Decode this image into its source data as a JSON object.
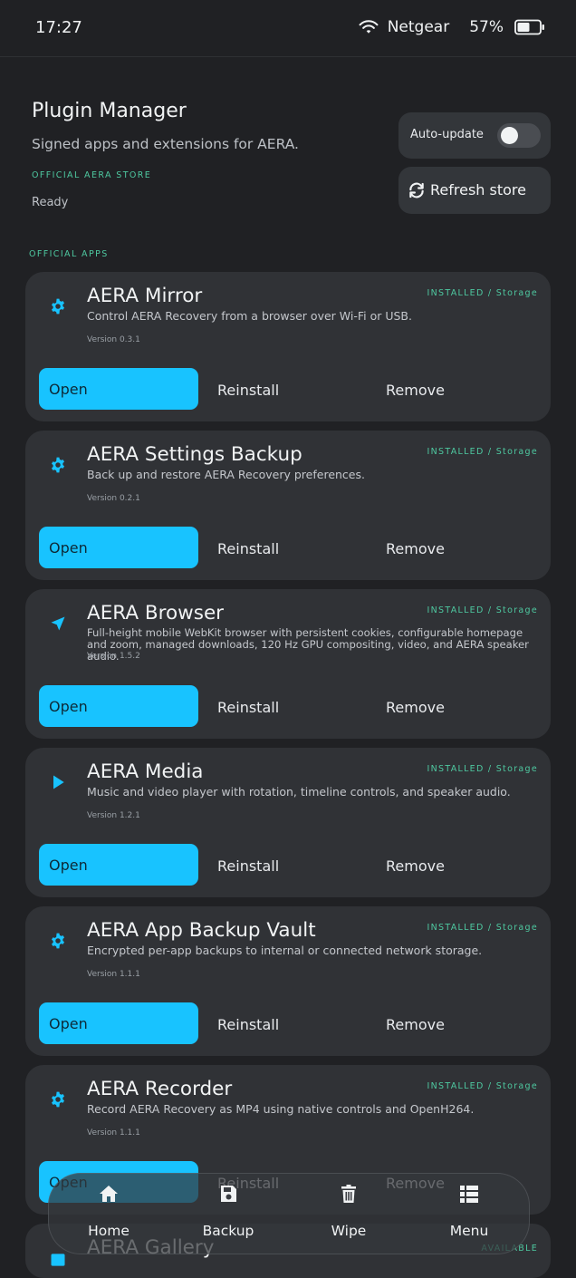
{
  "status_bar": {
    "time": "17:27",
    "network": "Netgear",
    "battery": "57%"
  },
  "header": {
    "title": "Plugin Manager",
    "subtitle": "Signed apps and extensions for AERA.",
    "store_label": "OFFICIAL AERA STORE",
    "status": "Ready",
    "auto_update_label": "Auto-update",
    "auto_update_on": false,
    "refresh_label": "Refresh store"
  },
  "section_label": "OFFICIAL APPS",
  "buttons": {
    "open": "Open",
    "reinstall": "Reinstall",
    "remove": "Remove"
  },
  "apps": [
    {
      "name": "AERA Mirror",
      "tag": "INSTALLED / Storage",
      "description": "Control AERA Recovery from a browser over Wi-Fi or USB.",
      "version": "Version 0.3.1",
      "icon": "gear-icon"
    },
    {
      "name": "AERA Settings Backup",
      "tag": "INSTALLED / Storage",
      "description": "Back up and restore AERA Recovery preferences.",
      "version": "Version 0.2.1",
      "icon": "gear-icon"
    },
    {
      "name": "AERA Browser",
      "tag": "INSTALLED / Storage",
      "description": "Full-height mobile WebKit browser with persistent cookies, configurable homepage and zoom, managed downloads, 120 Hz GPU compositing, video, and AERA speaker audio.",
      "version": "Version 1.5.2",
      "icon": "navigation-arrow-icon"
    },
    {
      "name": "AERA Media",
      "tag": "INSTALLED / Storage",
      "description": "Music and video player with rotation, timeline controls, and speaker audio.",
      "version": "Version 1.2.1",
      "icon": "play-icon"
    },
    {
      "name": "AERA App Backup Vault",
      "tag": "INSTALLED / Storage",
      "description": "Encrypted per-app backups to internal or connected network storage.",
      "version": "Version 1.1.1",
      "icon": "gear-icon"
    },
    {
      "name": "AERA Recorder",
      "tag": "INSTALLED / Storage",
      "description": "Record AERA Recovery as MP4 using native controls and OpenH264.",
      "version": "Version 1.1.1",
      "icon": "gear-icon"
    },
    {
      "name": "AERA Gallery",
      "tag": "AVAILABLE",
      "icon": "image-icon"
    }
  ],
  "nav": [
    {
      "label": "Home",
      "icon": "home-icon"
    },
    {
      "label": "Backup",
      "icon": "save-icon"
    },
    {
      "label": "Wipe",
      "icon": "trash-icon"
    },
    {
      "label": "Menu",
      "icon": "list-icon"
    }
  ],
  "colors": {
    "background": "#202124",
    "card": "#303236",
    "accent": "#18c3ff",
    "tag": "#4ec8a0"
  }
}
